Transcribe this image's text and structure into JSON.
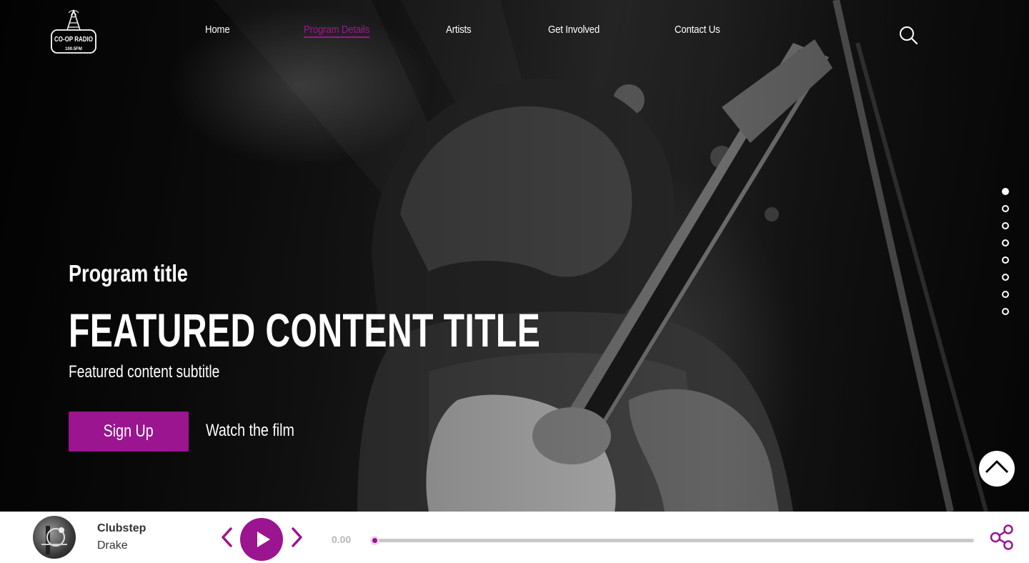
{
  "brand": {
    "logo_text": "CO-OP RADIO",
    "logo_frequency": "100.5FM"
  },
  "nav": {
    "items": [
      {
        "label": "Home",
        "active": false
      },
      {
        "label": "Program Details",
        "active": true
      },
      {
        "label": "Artists",
        "active": false
      },
      {
        "label": "Get Involved",
        "active": false
      },
      {
        "label": "Contact Us",
        "active": false
      }
    ],
    "search_icon": "search-icon"
  },
  "hero": {
    "program_title": "Program title",
    "featured_title": "FEATURED CONTENT TITLE",
    "featured_subtitle": "Featured content subtitle",
    "signup_label": "Sign Up",
    "watch_label": "Watch the film",
    "slides_total": 8,
    "active_slide": 1
  },
  "player": {
    "track_title": "Clubstep",
    "track_artist": "Drake",
    "time": "0.00",
    "progress": 0,
    "icons": {
      "prev": "chevron-left-icon",
      "play": "play-icon",
      "next": "chevron-right-icon",
      "share": "share-icon",
      "to_top": "chevron-up-icon"
    }
  },
  "colors": {
    "accent": "#9b1490",
    "player_bg": "#ffffff",
    "text_dark": "#333333",
    "time_text": "#b8b8b8"
  }
}
